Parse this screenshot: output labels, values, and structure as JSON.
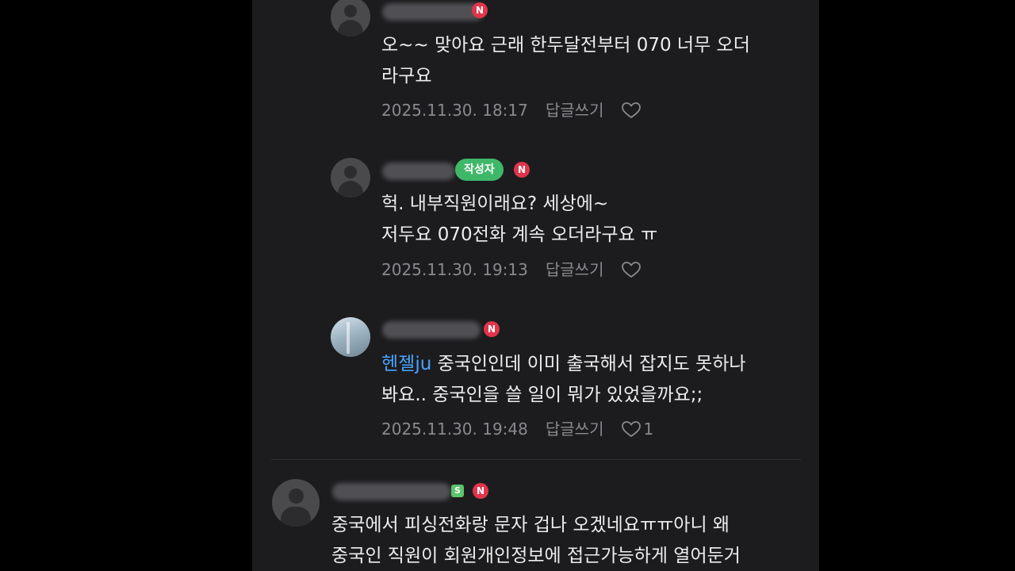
{
  "comments": [
    {
      "author_badge": "N",
      "text_lines": [
        "오~~ 맞아요 근래 한두달전부터 070 너무 오더",
        "라구요"
      ],
      "date": "2025.11.30. 18:17",
      "reply_label": "답글쓰기"
    },
    {
      "author_tag": "작성자",
      "author_badge": "N",
      "text_lines": [
        "헉. 내부직원이래요? 세상에~",
        "저두요 070전화 계속 오더라구요 ㅠ"
      ],
      "date": "2025.11.30. 19:13",
      "reply_label": "답글쓰기"
    },
    {
      "author_badge": "N",
      "mention": "헨젤ju",
      "text_line1": " 중국인인데 이미 출국해서 잡지도 못하나",
      "text_line2": "봐요.. 중국인을 쓸 일이 뭐가 있었을까요;;",
      "date": "2025.11.30. 19:48",
      "reply_label": "답글쓰기",
      "like_count": "1"
    },
    {
      "level_badge": "S",
      "author_badge": "N",
      "text_lines": [
        "중국에서 피싱전화랑 문자 겁나 오겠네요ㅠㅠ아니 왜",
        "중국인 직원이 회원개인정보에 접근가능하게 열어둔거"
      ]
    }
  ],
  "colors": {
    "background": "#1c1c1e",
    "mention": "#4aa3ff",
    "author_tag": "#3fb769",
    "n_badge": "#e0354b"
  },
  "icons": {
    "like": "heart-outline-icon",
    "avatar": "default-profile-icon"
  }
}
